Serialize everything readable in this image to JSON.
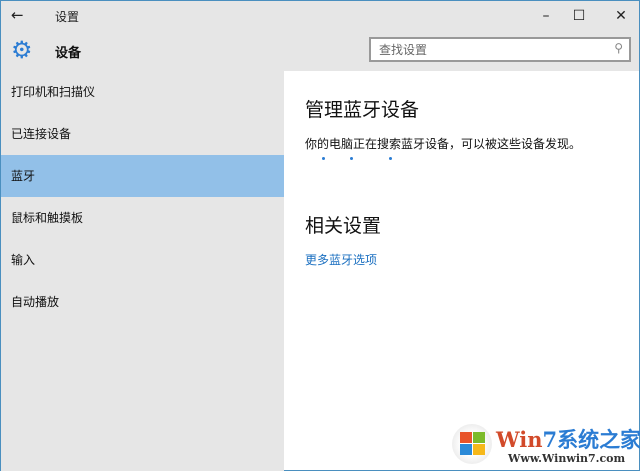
{
  "window": {
    "title": "设置",
    "back_icon": "arrow-left",
    "minimize": "–",
    "maximize": "☐",
    "close": "✕"
  },
  "header": {
    "title": "设备",
    "icon": "gear-icon",
    "search_placeholder": "查找设置",
    "search_icon": "search-icon"
  },
  "sidebar": {
    "items": [
      {
        "label": "打印机和扫描仪"
      },
      {
        "label": "已连接设备"
      },
      {
        "label": "蓝牙",
        "selected": true
      },
      {
        "label": "鼠标和触摸板"
      },
      {
        "label": "输入"
      },
      {
        "label": "自动播放"
      }
    ]
  },
  "main": {
    "heading": "管理蓝牙设备",
    "description": "你的电脑正在搜索蓝牙设备，可以被这些设备发现。",
    "related_heading": "相关设置",
    "more_link": "更多蓝牙选项"
  },
  "watermark": {
    "brand_a": "Win",
    "brand_b": "7系统之家",
    "url": "Www.Winwin7.com"
  },
  "colors": {
    "accent": "#2b7cd3",
    "selected": "#92c0e8",
    "sidebar": "#e6e6e6"
  }
}
